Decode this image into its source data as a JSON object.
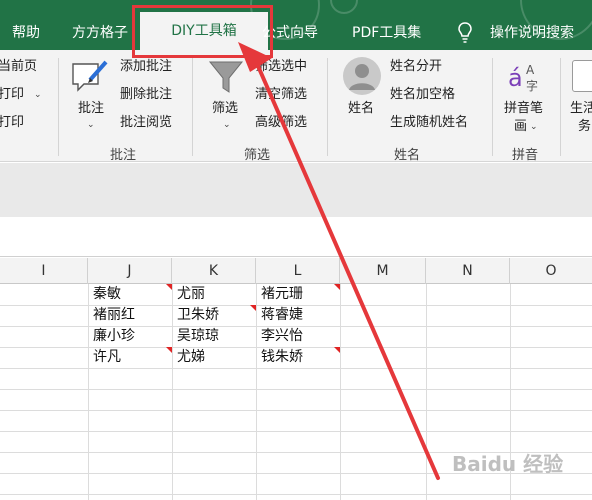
{
  "tabs": [
    {
      "label": "帮助"
    },
    {
      "label": "方方格子"
    },
    {
      "label": "DIY工具箱",
      "active": true
    },
    {
      "label": "公式向导"
    },
    {
      "label": "PDF工具集"
    },
    {
      "label": "操作说明搜索"
    }
  ],
  "ribbon": {
    "partial_left": [
      "当前页",
      "打印",
      "打印"
    ],
    "comments_group": {
      "label": "批注",
      "big_button": "批注",
      "items": [
        "添加批注",
        "删除批注",
        "批注阅览"
      ]
    },
    "filter_group": {
      "label": "筛选",
      "big_button": "筛选",
      "items": [
        "筛选选中",
        "清空筛选",
        "高级筛选"
      ]
    },
    "name_group": {
      "label": "姓名",
      "big_button": "姓名",
      "items": [
        "姓名分开",
        "姓名加空格",
        "生成随机姓名"
      ]
    },
    "pinyin_group": {
      "label": "拼音",
      "big_button_line1": "拼音笔",
      "big_button_line2": "画"
    },
    "partial_right": [
      "生活",
      "务"
    ]
  },
  "sheet": {
    "columns": [
      "I",
      "J",
      "K",
      "L",
      "M",
      "N",
      "O"
    ],
    "rows": [
      [
        "秦敏",
        "尤丽",
        "褚元珊"
      ],
      [
        "褚丽红",
        "卫朱娇",
        "蒋睿婕"
      ],
      [
        "廉小珍",
        "吴琼琼",
        "李兴怡"
      ],
      [
        "许凡",
        "尤娣",
        "钱朱娇"
      ]
    ]
  },
  "watermark": "Baidu 经验",
  "colors": {
    "tab_bar": "#217346",
    "annotation": "#e5383b",
    "comment_flag": "#e02424"
  }
}
